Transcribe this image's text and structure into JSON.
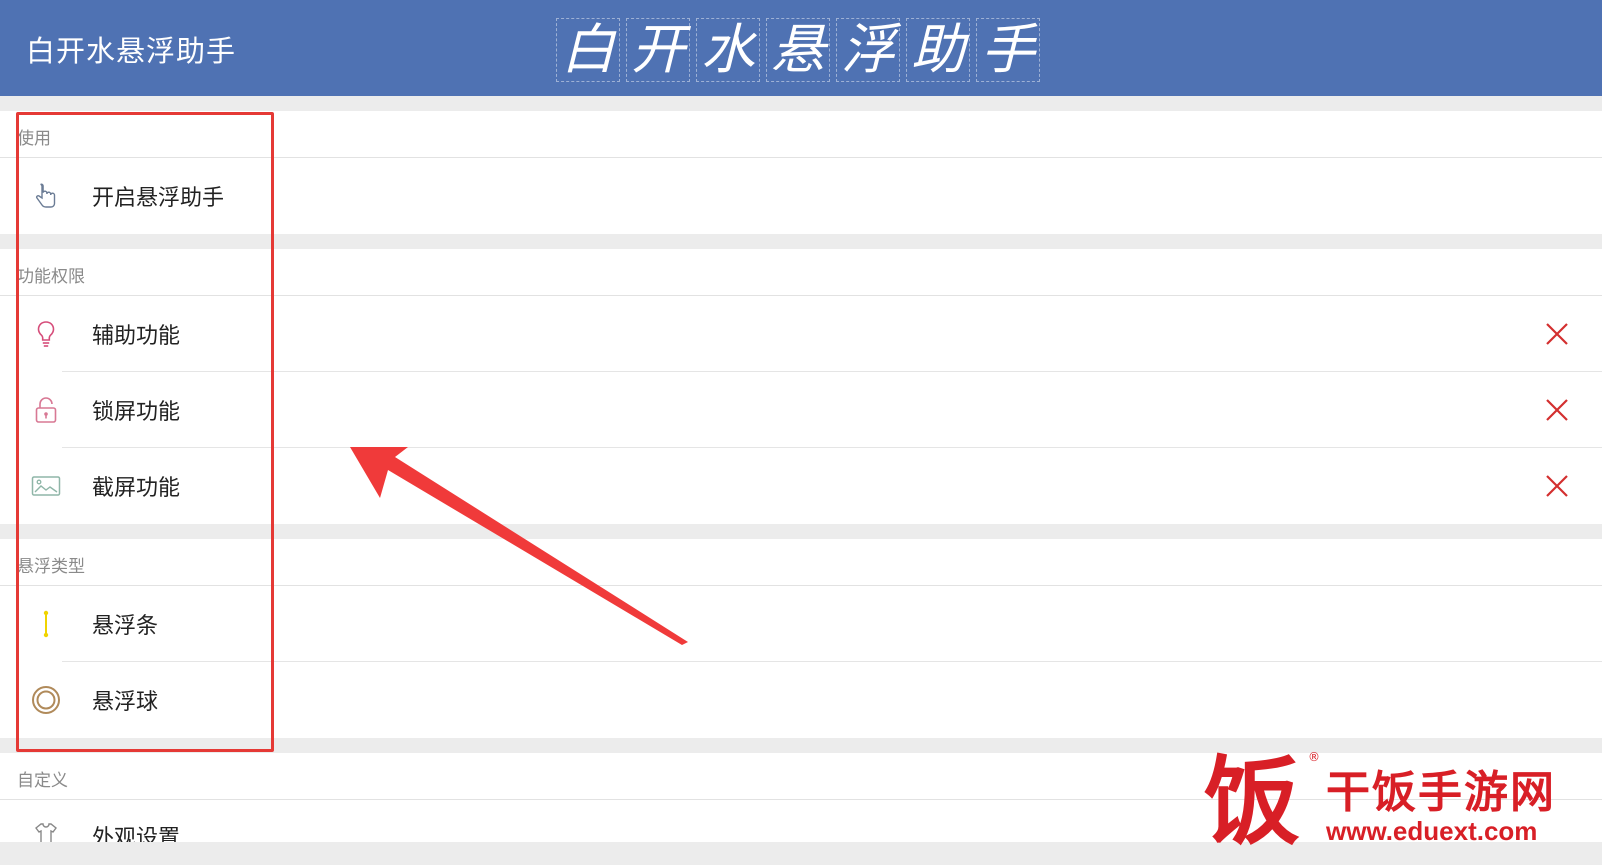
{
  "appbar": {
    "title": "白开水悬浮助手",
    "banner_chars": [
      "白",
      "开",
      "水",
      "悬",
      "浮",
      "助",
      "手"
    ]
  },
  "sections": [
    {
      "header": "使用",
      "items": [
        {
          "label": "开启悬浮助手",
          "icon": "hand-pointer-icon",
          "status": ""
        }
      ]
    },
    {
      "header": "功能权限",
      "items": [
        {
          "label": "辅助功能",
          "icon": "lightbulb-icon",
          "status": "disabled"
        },
        {
          "label": "锁屏功能",
          "icon": "lock-icon",
          "status": "disabled"
        },
        {
          "label": "截屏功能",
          "icon": "image-icon",
          "status": "disabled"
        }
      ]
    },
    {
      "header": "悬浮类型",
      "items": [
        {
          "label": "悬浮条",
          "icon": "float-bar-icon",
          "status": ""
        },
        {
          "label": "悬浮球",
          "icon": "float-ball-icon",
          "status": ""
        }
      ]
    },
    {
      "header": "自定义",
      "items": [
        {
          "label": "外观设置",
          "icon": "appearance-icon",
          "status": ""
        }
      ]
    }
  ],
  "watermark": {
    "logo_char": "饭",
    "name": "干饭手游网",
    "url": "www.eduext.com",
    "reg_mark": "®"
  },
  "colors": {
    "appbar": "#4f72b3",
    "status_x": "#d32f2f",
    "highlight": "#e53935"
  }
}
